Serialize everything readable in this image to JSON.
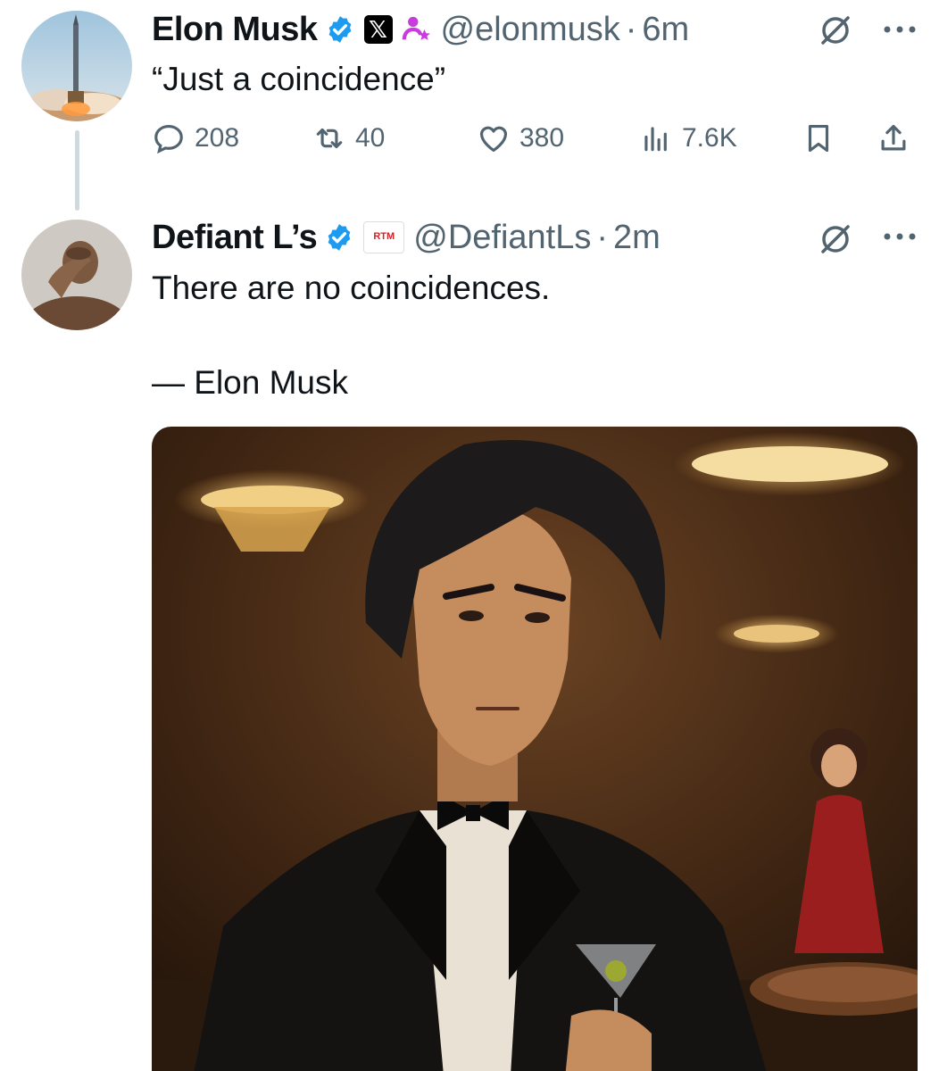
{
  "tweet1": {
    "name": "Elon Musk",
    "handle": "@elonmusk",
    "separator": "·",
    "time": "6m",
    "text": "“Just a coincidence”",
    "actions": {
      "replies": "208",
      "reposts": "40",
      "likes": "380",
      "views": "7.6K"
    },
    "icons": [
      "verified-icon",
      "x-logo-icon",
      "affiliate-icon",
      "grok-icon",
      "more-icon",
      "reply-icon",
      "repost-icon",
      "like-icon",
      "views-icon",
      "bookmark-icon",
      "share-icon"
    ]
  },
  "tweet2": {
    "name": "Defiant L’s",
    "handle": "@DefiantLs",
    "separator": "·",
    "time": "2m",
    "text_line1": "There are no coincidences.",
    "text_line2": "— Elon Musk",
    "affiliate_badge": "RTM",
    "icons": [
      "verified-icon",
      "rtm-badge-icon",
      "grok-icon",
      "more-icon"
    ]
  },
  "colors": {
    "verified": "#1d9bf0",
    "secondary_text": "#536471",
    "affiliate_pink": "#c93adf"
  }
}
